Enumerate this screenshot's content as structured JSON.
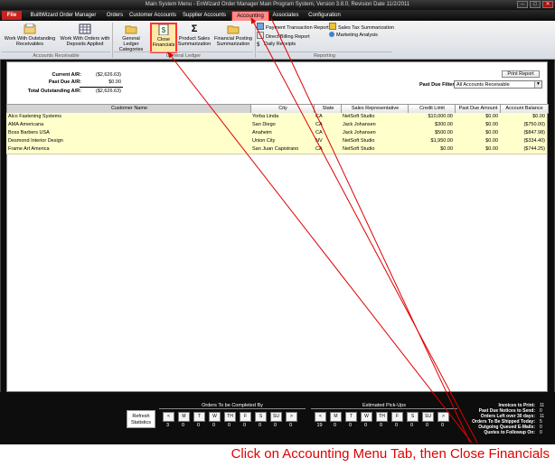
{
  "window": {
    "title": "Main System Menu - EnWizard Order Manager Main Program System, Version 3.8.0, Revision Date 11/2/2011",
    "controls": [
      "–",
      "□",
      "✕"
    ]
  },
  "menu": {
    "file": "File",
    "tabs": [
      "BuiltWizard Order Manager",
      "Orders",
      "Customer Accounts",
      "Supplier Accounts",
      "Accounting",
      "Associates",
      "Configuration"
    ]
  },
  "ribbon": {
    "work_outstanding": "Work With Outstanding Receivables",
    "work_deposits": "Work With Orders with Deposits Applied",
    "general_ledger_categories": "General Ledger Categories",
    "close_financials": "Close Financials",
    "product_sales": "Product Sales Summarization",
    "financial_posting": "Financial Posting Summarization",
    "payment_transaction_report": "Payment Transaction Report",
    "direct_billing_report": "Direct Billing Report",
    "daily_receipts": "Daily Receipts",
    "sales_tax_summarization": "Sales Tax Summarization",
    "marketing_analysis": "Marketing Analysis",
    "groups": {
      "ar": "Accounts Receivable",
      "gl": "General Ledger",
      "reporting": "Reporting"
    }
  },
  "summary": {
    "current_ar_label": "Current A/R:",
    "current_ar": "($2,626.63)",
    "past_due_label": "Past Due A/R:",
    "past_due": "$0.00",
    "total_label": "Total Outstanding A/R:",
    "total": "($2,626.63)"
  },
  "print_report": "Print Report",
  "past_due_filter": {
    "label": "Past Due Filter",
    "value": "All Accounts Receivable"
  },
  "table": {
    "headers": [
      "Customer Name",
      "City",
      "State",
      "Sales Representative",
      "Credit Limit",
      "Past Due Amount",
      "Account Balance"
    ],
    "rows": [
      [
        "Alco Fastening Systems",
        "Yorba Linda",
        "CA",
        "NetSoft Studio",
        "$10,000.00",
        "$0.00",
        "$0.00"
      ],
      [
        "AMA Americana",
        "San Diego",
        "CA",
        "Jack Johansen",
        "$300.00",
        "$0.00",
        "($750.00)"
      ],
      [
        "Boss Barbers USA",
        "Anaheim",
        "CA",
        "Jack Johansen",
        "$500.00",
        "$0.00",
        "($847.98)"
      ],
      [
        "Desmond Interior Design",
        "Union City",
        "NV",
        "NetSoft Studio",
        "$1,950.00",
        "$0.00",
        "($334.40)"
      ],
      [
        "Frame Art America",
        "San Juan Capistrano",
        "CA",
        "NetSoft Studio",
        "$0.00",
        "$0.00",
        "($744.25)"
      ]
    ]
  },
  "refresh": "Refresh Statistics",
  "orders_completed": {
    "title": "Orders To be Completed By",
    "days": [
      "<",
      "M",
      "T",
      "W",
      "TH",
      "F",
      "S",
      "SU",
      ">"
    ],
    "values": [
      "3",
      "0",
      "0",
      "0",
      "0",
      "0",
      "0",
      "0",
      "0"
    ]
  },
  "pickups": {
    "title": "Estimated Pick-Ups",
    "days": [
      "<",
      "M",
      "T",
      "W",
      "TH",
      "F",
      "S",
      "SU",
      ">"
    ],
    "values": [
      "19",
      "0",
      "0",
      "0",
      "0",
      "0",
      "0",
      "0",
      "0"
    ]
  },
  "stats": [
    {
      "label": "Invoices to Print:",
      "value": "11"
    },
    {
      "label": "Past Due Notices to Send:",
      "value": "0"
    },
    {
      "label": "Orders Left over 30 days:",
      "value": "11"
    },
    {
      "label": "Orders To Be Shipped Today:",
      "value": "5"
    },
    {
      "label": "Outgoing Queued E-Mails:",
      "value": "0"
    },
    {
      "label": "Quotes to Followup On:",
      "value": "0"
    }
  ],
  "caption": "Click on Accounting Menu Tab, then Close Financials",
  "colors": {
    "accent_red": "#e00000",
    "row_yellow": "#ffffcc",
    "file_red": "#c9211e"
  }
}
